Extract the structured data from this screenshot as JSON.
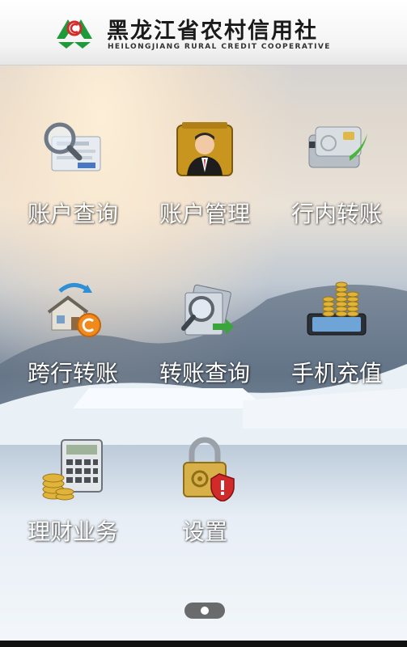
{
  "header": {
    "title": "黑龙江省农村信用社",
    "subtitle": "HEILONGJIANG RURAL CREDIT COOPERATIVE",
    "brand_color": "#1f9a3a"
  },
  "menu": {
    "items": [
      {
        "label": "账户查询",
        "icon": "magnifier-document-icon"
      },
      {
        "label": "账户管理",
        "icon": "account-manager-icon"
      },
      {
        "label": "行内转账",
        "icon": "bank-card-icon"
      },
      {
        "label": "跨行转账",
        "icon": "bank-transfer-icon"
      },
      {
        "label": "转账查询",
        "icon": "transfer-search-icon"
      },
      {
        "label": "手机充值",
        "icon": "phone-coins-icon"
      },
      {
        "label": "理财业务",
        "icon": "calculator-coins-icon"
      },
      {
        "label": "设置",
        "icon": "padlock-shield-icon"
      }
    ]
  },
  "pager": {
    "current": 1,
    "total": 1
  }
}
